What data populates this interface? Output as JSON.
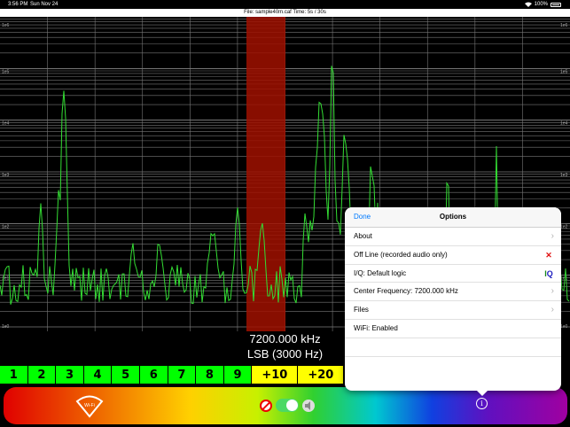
{
  "status": {
    "time": "3:56 PM",
    "date": "Sun Nov 24",
    "battery": "100%"
  },
  "file_info": "File: sample40m.caf  Time:  5s /  30s",
  "spectrum": {
    "y_labels": [
      "1e6",
      "1e5",
      "1e4",
      "1e3",
      "1e2",
      "1e1",
      "1e0"
    ],
    "trace_color": "#33dd33",
    "marker_color": "#a01000"
  },
  "readout": {
    "frequency": "7200.000 kHz",
    "mode": "LSB (3000 Hz)"
  },
  "keys": {
    "numbers": [
      "1",
      "2",
      "3",
      "4",
      "5",
      "6",
      "7",
      "8",
      "9"
    ],
    "plus": [
      "+10",
      "+20"
    ]
  },
  "toolbar": {
    "wifi_label": "Wi-Fi",
    "info_symbol": "i"
  },
  "options": {
    "done_label": "Done",
    "title": "Options",
    "rows": [
      {
        "label": "About",
        "accessory": "chevron"
      },
      {
        "label": "Off Line (recorded audio only)",
        "accessory": "x-badge"
      },
      {
        "label": "I/Q: Default logic",
        "accessory": "iq-badge"
      },
      {
        "label": "Center Frequency: 7200.000 kHz",
        "accessory": "chevron"
      },
      {
        "label": "Files",
        "accessory": "chevron"
      },
      {
        "label": "WiFi: Enabled",
        "accessory": "none"
      }
    ],
    "chevron_symbol": "›",
    "iq_badge": {
      "i": "I",
      "q": "Q"
    },
    "x_badge": "✕"
  }
}
